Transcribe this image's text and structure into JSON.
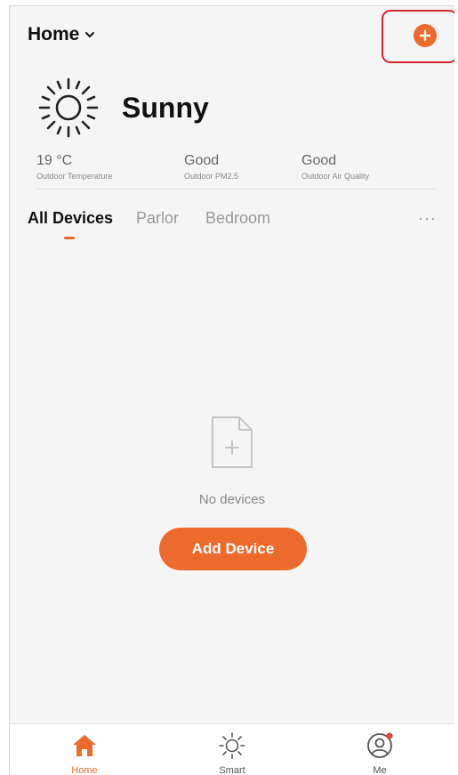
{
  "header": {
    "home_title": "Home",
    "add_icon": "plus-circle-icon",
    "accent_color": "#ec6a2c",
    "highlight_color": "#d8242f"
  },
  "weather": {
    "icon": "sun-icon",
    "condition": "Sunny"
  },
  "stats": [
    {
      "value": "19 °C",
      "label": "Outdoor Temperature"
    },
    {
      "value": "Good",
      "label": "Outdoor PM2.5"
    },
    {
      "value": "Good",
      "label": "Outdoor Air Quality"
    }
  ],
  "tabs": [
    {
      "label": "All Devices",
      "active": true
    },
    {
      "label": "Parlor",
      "active": false
    },
    {
      "label": "Bedroom",
      "active": false
    }
  ],
  "more_label": "···",
  "empty_state": {
    "icon": "add-document-icon",
    "text": "No devices",
    "button_label": "Add Device"
  },
  "bottom_nav": [
    {
      "label": "Home",
      "icon": "home-icon",
      "active": true
    },
    {
      "label": "Smart",
      "icon": "sun-icon",
      "active": false
    },
    {
      "label": "Me",
      "icon": "profile-icon",
      "active": false
    }
  ]
}
